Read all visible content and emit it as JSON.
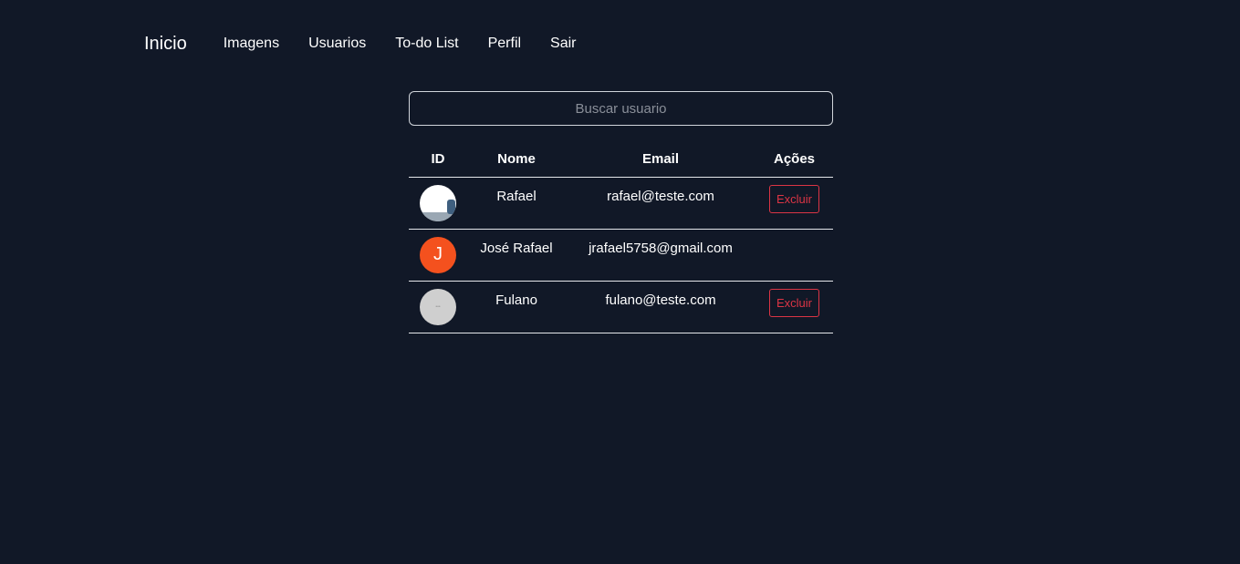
{
  "nav": {
    "brand": "Inicio",
    "links": [
      "Imagens",
      "Usuarios",
      "To-do List",
      "Perfil",
      "Sair"
    ]
  },
  "search": {
    "placeholder": "Buscar usuario",
    "value": ""
  },
  "table": {
    "headers": [
      "ID",
      "Nome",
      "Email",
      "Ações"
    ],
    "rows": [
      {
        "avatar": "photo",
        "name": "Rafael",
        "email": "rafael@teste.com",
        "action": "Excluir"
      },
      {
        "avatar": "J",
        "name": "José Rafael",
        "email": "jrafael5758@gmail.com",
        "action": ""
      },
      {
        "avatar": "placeholder",
        "name": "Fulano",
        "email": "fulano@teste.com",
        "action": "Excluir"
      }
    ]
  },
  "colors": {
    "background": "#111827",
    "danger": "#dc3545",
    "avatar_letter_bg": "#f4511e"
  }
}
